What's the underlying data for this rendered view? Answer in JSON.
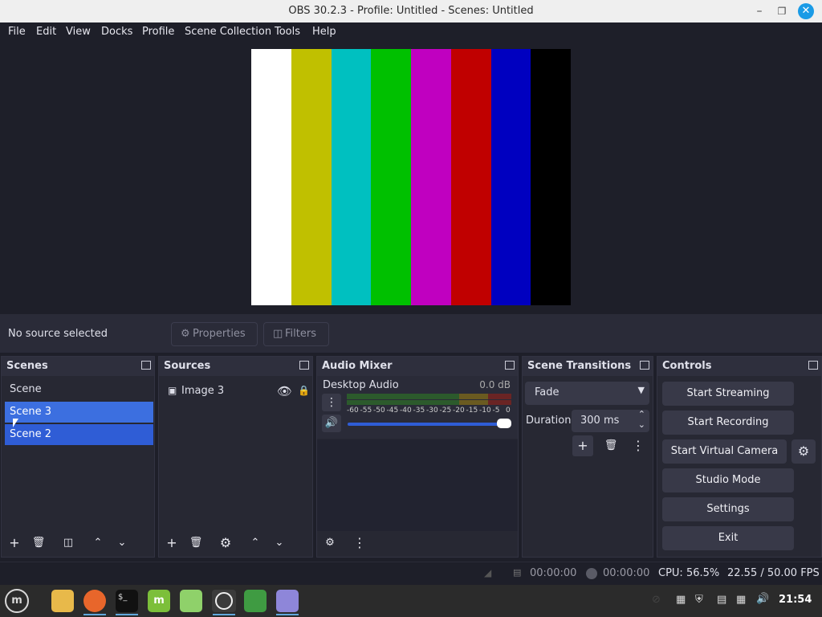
{
  "window": {
    "title": "OBS 30.2.3 - Profile: Untitled - Scenes: Untitled"
  },
  "menu": [
    "File",
    "Edit",
    "View",
    "Docks",
    "Profile",
    "Scene Collection",
    "Tools",
    "Help"
  ],
  "preview": {
    "bars": [
      "#ffffff",
      "#c0c000",
      "#00c0c0",
      "#00c000",
      "#c000c0",
      "#c00000",
      "#0000c0",
      "#000000"
    ]
  },
  "source_toolbar": {
    "status": "No source selected",
    "properties": "Properties",
    "filters": "Filters"
  },
  "scenes": {
    "title": "Scenes",
    "items": [
      "Scene",
      "Scene 3",
      "Scene 2"
    ],
    "selected": "Scene 3"
  },
  "sources": {
    "title": "Sources",
    "items": [
      "Image 3"
    ]
  },
  "audio": {
    "title": "Audio Mixer",
    "channel": "Desktop Audio",
    "level": "0.0 dB",
    "scale": [
      "-60",
      "-55",
      "-50",
      "-45",
      "-40",
      "-35",
      "-30",
      "-25",
      "-20",
      "-15",
      "-10",
      "-5",
      "0"
    ]
  },
  "transitions": {
    "title": "Scene Transitions",
    "type": "Fade",
    "duration_label": "Duration",
    "duration": "300 ms"
  },
  "controls": {
    "title": "Controls",
    "start_streaming": "Start Streaming",
    "start_recording": "Start Recording",
    "start_virtual_camera": "Start Virtual Camera",
    "studio_mode": "Studio Mode",
    "settings": "Settings",
    "exit": "Exit"
  },
  "status": {
    "stream_time": "00:00:00",
    "rec_time": "00:00:00",
    "cpu": "CPU: 56.5%",
    "fps": "22.55 / 50.00 FPS"
  },
  "taskbar": {
    "clock": "21:54"
  },
  "colors": {
    "accent": "#2f5dd6",
    "selected": "#3c6fe0"
  }
}
